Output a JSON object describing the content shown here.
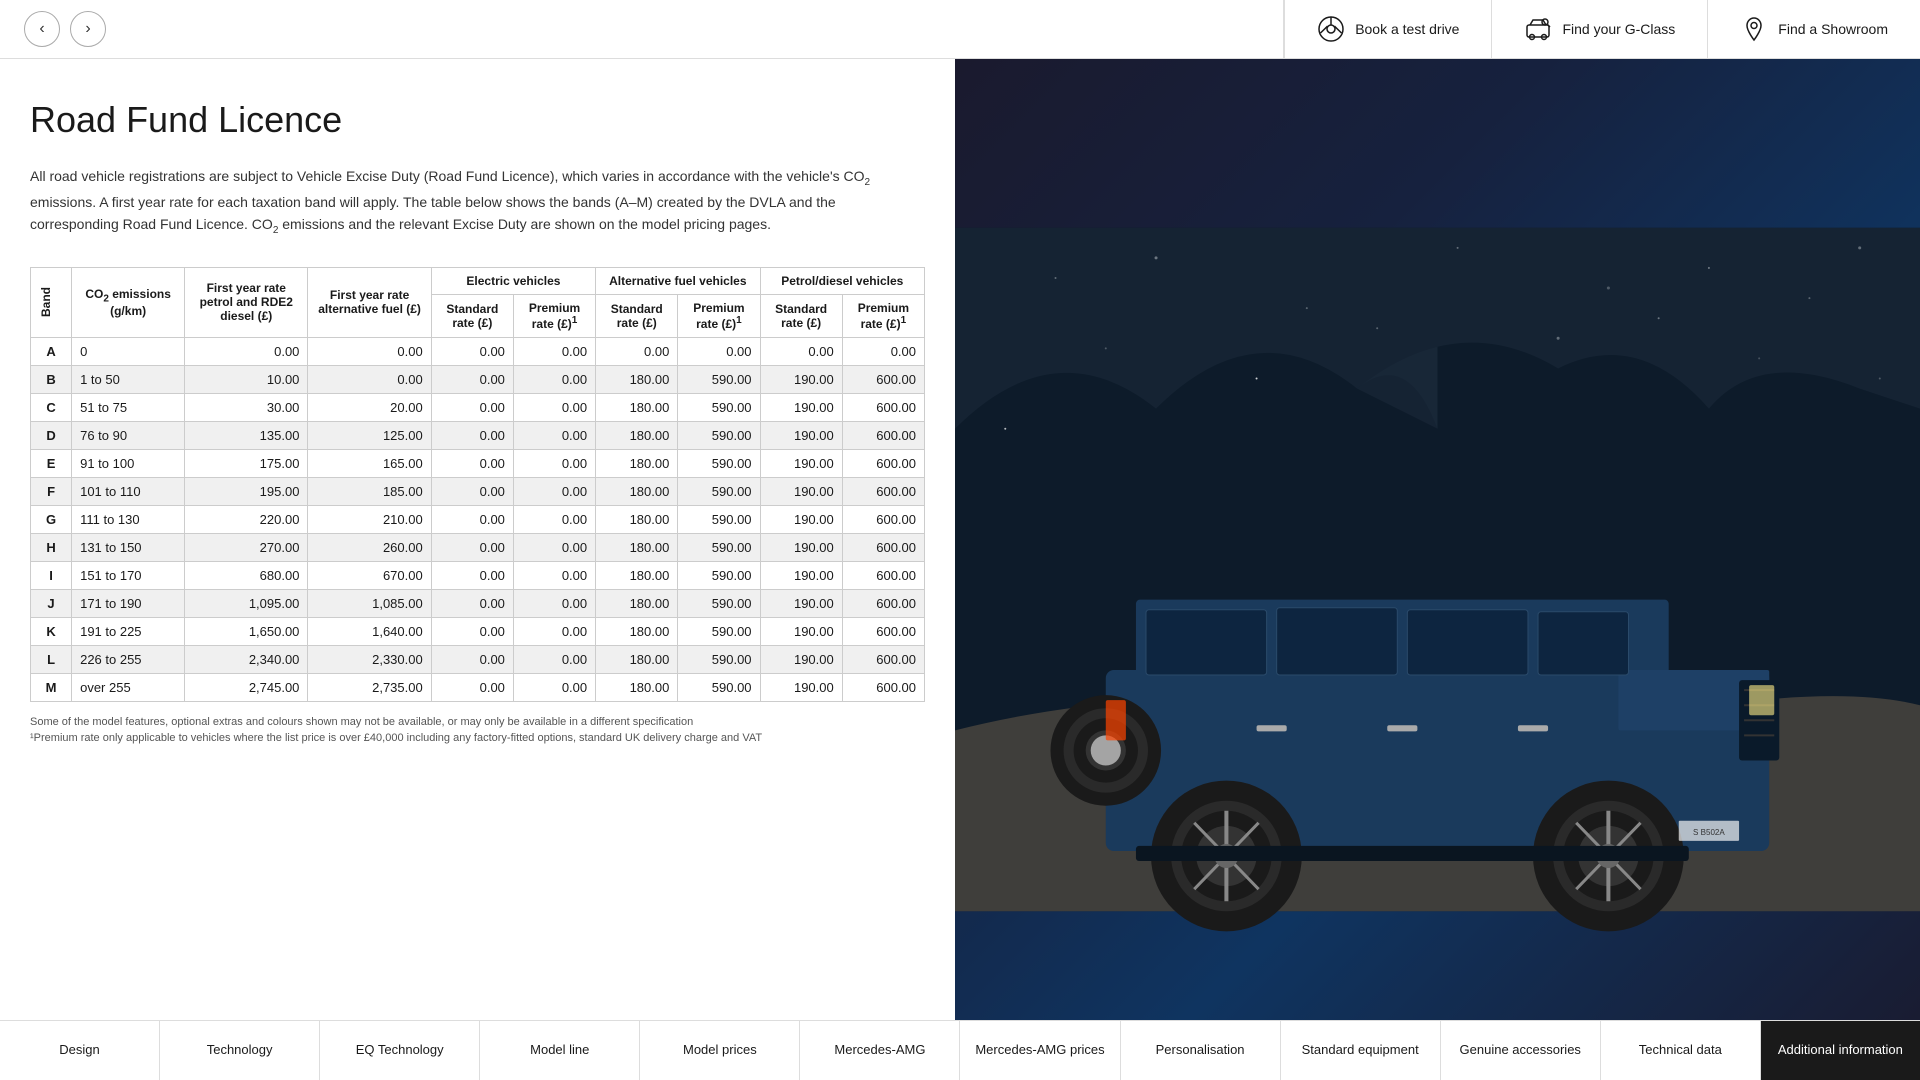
{
  "nav": {
    "back_label": "‹",
    "forward_label": "›",
    "book_test_drive_label": "Book a test drive",
    "find_g_class_label": "Find your G-Class",
    "find_showroom_label": "Find a Showroom"
  },
  "page": {
    "title": "Road Fund Licence",
    "description_1": "All road vehicle registrations are subject to Vehicle Excise Duty (Road Fund Licence), which varies in accordance with the vehicle's CO",
    "co2_sub": "2",
    "description_2": " emissions. A first year rate for each taxation band will apply. The table below shows the bands (A–M) created by the DVLA and the corresponding Road Fund Licence. CO",
    "co2_sub2": "2",
    "description_3": " emissions and the relevant Excise Duty are shown on the model pricing pages."
  },
  "table": {
    "headers": {
      "band": "Band",
      "co2": "CO₂ emissions (g/km)",
      "petrol_rde2": "First year rate petrol and RDE2 diesel (£)",
      "alt_fuel": "First year rate alternative fuel (£)",
      "electric_group": "Electric vehicles",
      "alt_fuel_group": "Alternative fuel vehicles",
      "petrol_diesel_group": "Petrol/diesel vehicles",
      "std_rate": "Standard rate (£)",
      "premium_rate": "Premium rate (£)¹",
      "std_rate_alt": "Standard rate (£)",
      "premium_rate_alt": "Premium rate (£)¹",
      "std_rate_petrol": "Standard rate (£)",
      "premium_rate_petrol": "Premium rate (£)¹"
    },
    "rows": [
      {
        "band": "A",
        "co2": "0",
        "petrol_rde2": "0.00",
        "alt_fuel": "0.00",
        "ev_std": "0.00",
        "ev_prem": "0.00",
        "alt_std": "0.00",
        "alt_prem": "0.00",
        "pet_std": "0.00",
        "pet_prem": "0.00"
      },
      {
        "band": "B",
        "co2": "1 to 50",
        "petrol_rde2": "10.00",
        "alt_fuel": "0.00",
        "ev_std": "0.00",
        "ev_prem": "0.00",
        "alt_std": "180.00",
        "alt_prem": "590.00",
        "pet_std": "190.00",
        "pet_prem": "600.00"
      },
      {
        "band": "C",
        "co2": "51 to 75",
        "petrol_rde2": "30.00",
        "alt_fuel": "20.00",
        "ev_std": "0.00",
        "ev_prem": "0.00",
        "alt_std": "180.00",
        "alt_prem": "590.00",
        "pet_std": "190.00",
        "pet_prem": "600.00"
      },
      {
        "band": "D",
        "co2": "76 to 90",
        "petrol_rde2": "135.00",
        "alt_fuel": "125.00",
        "ev_std": "0.00",
        "ev_prem": "0.00",
        "alt_std": "180.00",
        "alt_prem": "590.00",
        "pet_std": "190.00",
        "pet_prem": "600.00"
      },
      {
        "band": "E",
        "co2": "91 to 100",
        "petrol_rde2": "175.00",
        "alt_fuel": "165.00",
        "ev_std": "0.00",
        "ev_prem": "0.00",
        "alt_std": "180.00",
        "alt_prem": "590.00",
        "pet_std": "190.00",
        "pet_prem": "600.00"
      },
      {
        "band": "F",
        "co2": "101 to 110",
        "petrol_rde2": "195.00",
        "alt_fuel": "185.00",
        "ev_std": "0.00",
        "ev_prem": "0.00",
        "alt_std": "180.00",
        "alt_prem": "590.00",
        "pet_std": "190.00",
        "pet_prem": "600.00"
      },
      {
        "band": "G",
        "co2": "111 to 130",
        "petrol_rde2": "220.00",
        "alt_fuel": "210.00",
        "ev_std": "0.00",
        "ev_prem": "0.00",
        "alt_std": "180.00",
        "alt_prem": "590.00",
        "pet_std": "190.00",
        "pet_prem": "600.00"
      },
      {
        "band": "H",
        "co2": "131 to 150",
        "petrol_rde2": "270.00",
        "alt_fuel": "260.00",
        "ev_std": "0.00",
        "ev_prem": "0.00",
        "alt_std": "180.00",
        "alt_prem": "590.00",
        "pet_std": "190.00",
        "pet_prem": "600.00"
      },
      {
        "band": "I",
        "co2": "151 to 170",
        "petrol_rde2": "680.00",
        "alt_fuel": "670.00",
        "ev_std": "0.00",
        "ev_prem": "0.00",
        "alt_std": "180.00",
        "alt_prem": "590.00",
        "pet_std": "190.00",
        "pet_prem": "600.00"
      },
      {
        "band": "J",
        "co2": "171 to 190",
        "petrol_rde2": "1,095.00",
        "alt_fuel": "1,085.00",
        "ev_std": "0.00",
        "ev_prem": "0.00",
        "alt_std": "180.00",
        "alt_prem": "590.00",
        "pet_std": "190.00",
        "pet_prem": "600.00"
      },
      {
        "band": "K",
        "co2": "191 to 225",
        "petrol_rde2": "1,650.00",
        "alt_fuel": "1,640.00",
        "ev_std": "0.00",
        "ev_prem": "0.00",
        "alt_std": "180.00",
        "alt_prem": "590.00",
        "pet_std": "190.00",
        "pet_prem": "600.00"
      },
      {
        "band": "L",
        "co2": "226 to 255",
        "petrol_rde2": "2,340.00",
        "alt_fuel": "2,330.00",
        "ev_std": "0.00",
        "ev_prem": "0.00",
        "alt_std": "180.00",
        "alt_prem": "590.00",
        "pet_std": "190.00",
        "pet_prem": "600.00"
      },
      {
        "band": "M",
        "co2": "over 255",
        "petrol_rde2": "2,745.00",
        "alt_fuel": "2,735.00",
        "ev_std": "0.00",
        "ev_prem": "0.00",
        "alt_std": "180.00",
        "alt_prem": "590.00",
        "pet_std": "190.00",
        "pet_prem": "600.00"
      }
    ]
  },
  "footnotes": {
    "line1": "Some of the model features, optional extras and colours shown may not be available, or may only be available in a different specification",
    "line2": "¹Premium rate only applicable to vehicles where the list price is over £40,000 including any factory-fitted options, standard UK delivery charge and VAT"
  },
  "bottom_nav": [
    {
      "id": "design",
      "label": "Design"
    },
    {
      "id": "technology",
      "label": "Technology"
    },
    {
      "id": "eq-technology",
      "label": "EQ Technology"
    },
    {
      "id": "model-line",
      "label": "Model line"
    },
    {
      "id": "model-prices",
      "label": "Model prices"
    },
    {
      "id": "mercedes-amg",
      "label": "Mercedes-AMG"
    },
    {
      "id": "mercedes-amg-prices",
      "label": "Mercedes-AMG prices"
    },
    {
      "id": "personalisation",
      "label": "Personalisation"
    },
    {
      "id": "standard-equipment",
      "label": "Standard equipment"
    },
    {
      "id": "genuine-accessories",
      "label": "Genuine accessories"
    },
    {
      "id": "technical-data",
      "label": "Technical data"
    },
    {
      "id": "additional-information",
      "label": "Additional information",
      "active": true
    }
  ]
}
